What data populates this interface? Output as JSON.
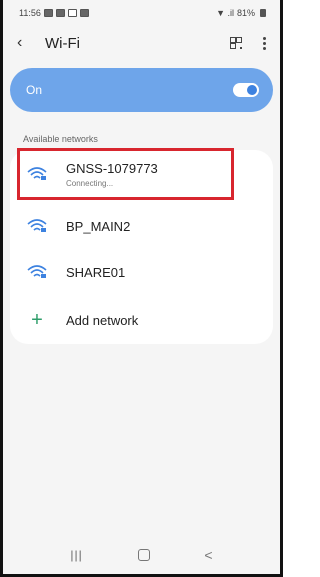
{
  "status_bar": {
    "time": "11:56",
    "battery": "81%",
    "signal": "▼ .il"
  },
  "header": {
    "title": "Wi-Fi",
    "back_icon": "chevron-left-icon",
    "qr_icon": "qr-scan-icon",
    "more_icon": "more-vertical-icon"
  },
  "wifi_toggle": {
    "label": "On",
    "state": "on",
    "accent": "#6ea5ea"
  },
  "available_label": "Available networks",
  "networks": [
    {
      "name": "GNSS-1079773",
      "status": "Connecting...",
      "icon": "wifi-lock-icon"
    },
    {
      "name": "BP_MAIN2",
      "status": "",
      "icon": "wifi-lock-icon"
    },
    {
      "name": "SHARE01",
      "status": "",
      "icon": "wifi-lock-icon"
    }
  ],
  "add_network": {
    "label": "Add network",
    "icon": "plus-icon",
    "color": "#2e9d6a"
  },
  "highlight_color": "#d8262e",
  "navbar": {
    "recent_icon": "recent-apps-icon",
    "home_icon": "home-icon",
    "back_icon": "back-icon"
  }
}
